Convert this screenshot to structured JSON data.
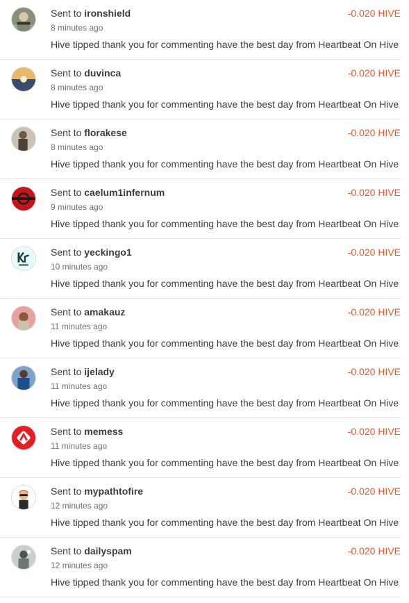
{
  "transfers": [
    {
      "prefix": "Sent to",
      "user": "ironshield",
      "time": "8 minutes ago",
      "memo": "Hive tipped thank you for commenting have the best day from Heartbeat On Hive",
      "amount": "-0.020 HIVE"
    },
    {
      "prefix": "Sent to",
      "user": "duvinca",
      "time": "8 minutes ago",
      "memo": "Hive tipped thank you for commenting have the best day from Heartbeat On Hive",
      "amount": "-0.020 HIVE"
    },
    {
      "prefix": "Sent to",
      "user": "florakese",
      "time": "8 minutes ago",
      "memo": "Hive tipped thank you for commenting have the best day from Heartbeat On Hive",
      "amount": "-0.020 HIVE"
    },
    {
      "prefix": "Sent to",
      "user": "caelum1infernum",
      "time": "9 minutes ago",
      "memo": "Hive tipped thank you for commenting have the best day from Heartbeat On Hive",
      "amount": "-0.020 HIVE"
    },
    {
      "prefix": "Sent to",
      "user": "yeckingo1",
      "time": "10 minutes ago",
      "memo": "Hive tipped thank you for commenting have the best day from Heartbeat On Hive",
      "amount": "-0.020 HIVE"
    },
    {
      "prefix": "Sent to",
      "user": "amakauz",
      "time": "11 minutes ago",
      "memo": "Hive tipped thank you for commenting have the best day from Heartbeat On Hive",
      "amount": "-0.020 HIVE"
    },
    {
      "prefix": "Sent to",
      "user": "ijelady",
      "time": "11 minutes ago",
      "memo": "Hive tipped thank you for commenting have the best day from Heartbeat On Hive",
      "amount": "-0.020 HIVE"
    },
    {
      "prefix": "Sent to",
      "user": "memess",
      "time": "11 minutes ago",
      "memo": "Hive tipped thank you for commenting have the best day from Heartbeat On Hive",
      "amount": "-0.020 HIVE"
    },
    {
      "prefix": "Sent to",
      "user": "mypathtofire",
      "time": "12 minutes ago",
      "memo": "Hive tipped thank you for commenting have the best day from Heartbeat On Hive",
      "amount": "-0.020 HIVE"
    },
    {
      "prefix": "Sent to",
      "user": "dailyspam",
      "time": "12 minutes ago",
      "memo": "Hive tipped thank you for commenting have the best day from Heartbeat On Hive",
      "amount": "-0.020 HIVE"
    }
  ],
  "avatars": [
    {
      "icon": "ironshield-avatar-icon",
      "bg": "#8a8f7a",
      "fg": "#2f3a2a"
    },
    {
      "icon": "duvinca-avatar-icon",
      "bg": "#d9a15a",
      "fg": "#3b4b6b"
    },
    {
      "icon": "florakese-avatar-icon",
      "bg": "#c9c2b6",
      "fg": "#4a4238"
    },
    {
      "icon": "caelum1infernum-avatar-icon",
      "bg": "#c4141c",
      "fg": "#1a1a1a"
    },
    {
      "icon": "yeckingo1-avatar-icon",
      "bg": "#e6fbfb",
      "fg": "#1d3c3c"
    },
    {
      "icon": "amakauz-avatar-icon",
      "bg": "#e7a1a1",
      "fg": "#8b5a3c"
    },
    {
      "icon": "ijelady-avatar-icon",
      "bg": "#7fa3c6",
      "fg": "#1f4e8c"
    },
    {
      "icon": "memess-avatar-icon",
      "bg": "#e41e26",
      "fg": "#ffffff"
    },
    {
      "icon": "mypathtofire-avatar-icon",
      "bg": "#ffffff",
      "fg": "#c96b2c"
    },
    {
      "icon": "dailyspam-avatar-icon",
      "bg": "#c8d0cf",
      "fg": "#4c5552"
    }
  ]
}
